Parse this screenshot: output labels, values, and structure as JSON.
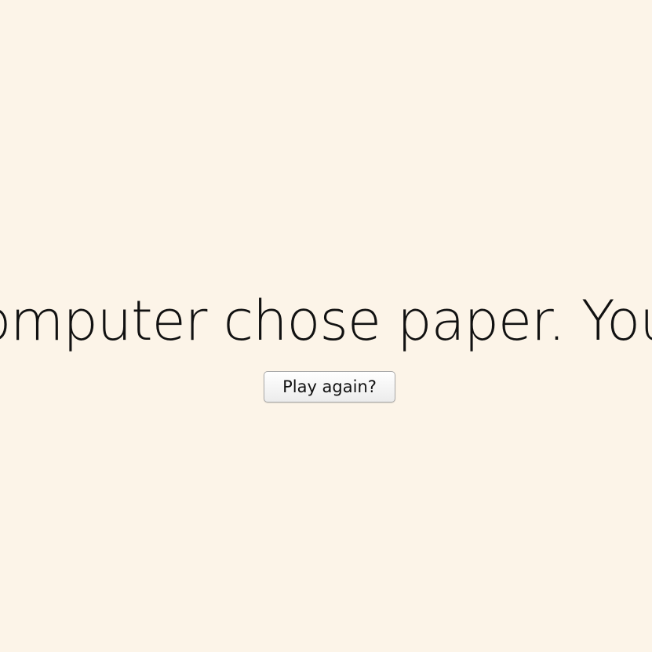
{
  "result": {
    "message": "The computer chose paper. You lose!"
  },
  "actions": {
    "play_again_label": "Play again?"
  },
  "colors": {
    "background": "#fcf4e8",
    "text": "#111111"
  }
}
